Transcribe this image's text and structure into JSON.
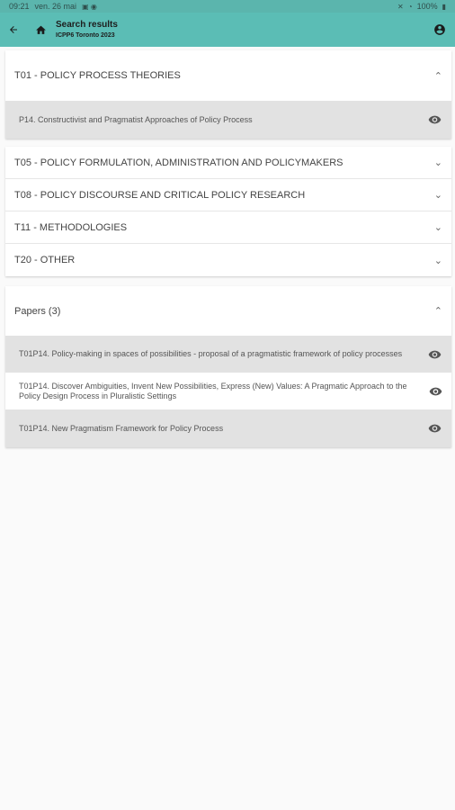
{
  "status": {
    "time": "09:21",
    "date": "ven. 26 mai",
    "battery": "100%"
  },
  "appbar": {
    "title": "Search results",
    "subtitle": "ICPP6 Toronto 2023"
  },
  "topics": [
    {
      "label": "T01 - POLICY PROCESS THEORIES",
      "expanded": true,
      "children": [
        {
          "label": "P14. Constructivist and Pragmatist Approaches of Policy Process"
        }
      ]
    },
    {
      "label": "T05 - POLICY FORMULATION, ADMINISTRATION AND POLICYMAKERS",
      "expanded": false
    },
    {
      "label": "T08 - POLICY DISCOURSE AND CRITICAL POLICY RESEARCH",
      "expanded": false
    },
    {
      "label": "T11 - METHODOLOGIES",
      "expanded": false
    },
    {
      "label": "T20 - OTHER",
      "expanded": false
    }
  ],
  "papers": {
    "header": "Papers (3)",
    "items": [
      {
        "label": "T01P14. Policy-making in spaces of possibilities - proposal of a pragmatistic framework of policy processes"
      },
      {
        "label": "T01P14. Discover Ambiguities, Invent New Possibilities, Express (New) Values:  A Pragmatic Approach to the Policy Design Process in Pluralistic Settings"
      },
      {
        "label": "T01P14. New Pragmatism Framework for Policy Process"
      }
    ]
  },
  "icons": {
    "back": "arrow-left-icon",
    "home": "home-icon",
    "account": "account-circle-icon",
    "view": "eye-icon",
    "chevron_up": "chevron-up-icon",
    "chevron_down": "chevron-down-icon"
  },
  "colors": {
    "appbar": "#5bbdb5",
    "statusbar": "#5bb5ad",
    "selected_row": "#e2e2e2"
  }
}
